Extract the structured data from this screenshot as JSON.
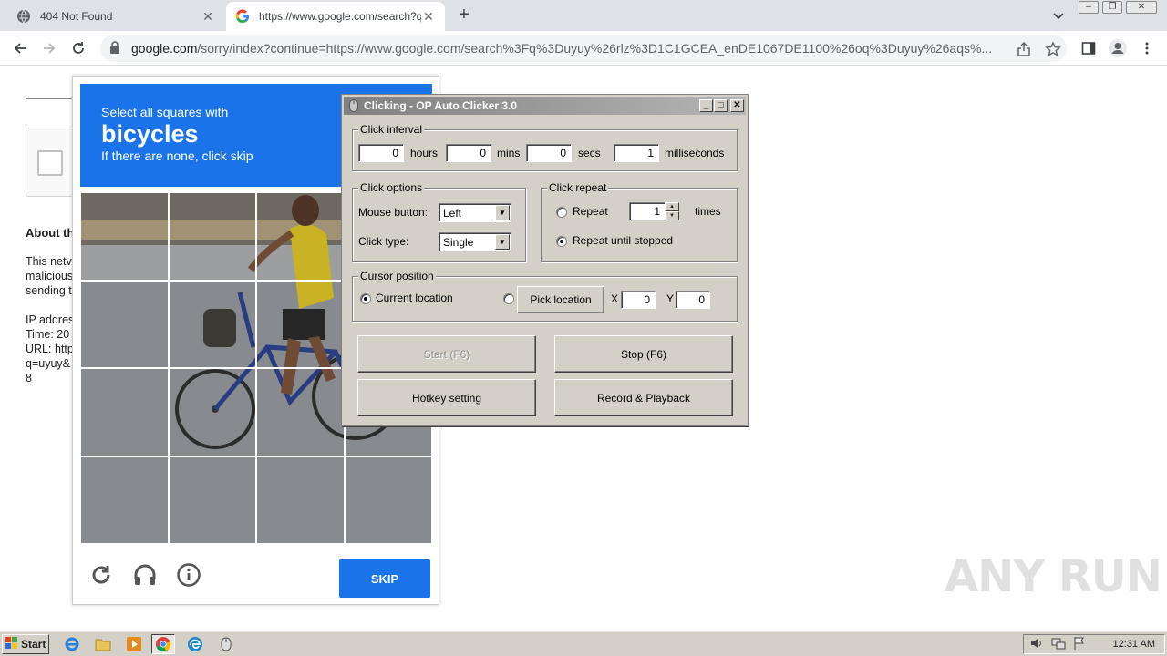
{
  "browser": {
    "tabs": [
      {
        "title": "404 Not Found",
        "active": false
      },
      {
        "title": "https://www.google.com/search?q=",
        "active": true
      }
    ],
    "new_tab_symbol": "+",
    "close_symbol": "✕",
    "url_host": "google.com",
    "url_rest": "/sorry/index?continue=https://www.google.com/search%3Fq%3Duyuy%26rlz%3D1C1GCEA_enDE1067DE1100%26oq%3Duyuy%26aqs%..."
  },
  "page": {
    "about_heading": "About th",
    "lines": [
      "This netv",
      "malicious",
      "sending t",
      "",
      "IP addres",
      "Time: 20",
      "URL: http",
      "q=uyuy&",
      "8"
    ]
  },
  "captcha": {
    "instruction": "Select all squares with",
    "keyword": "bicycles",
    "hint": "If there are none, click skip",
    "skip_label": "SKIP",
    "grid_size": 4
  },
  "clicker": {
    "title": "Clicking - OP Auto Clicker 3.0",
    "interval": {
      "label": "Click interval",
      "hours": "0",
      "hours_label": "hours",
      "mins": "0",
      "mins_label": "mins",
      "secs": "0",
      "secs_label": "secs",
      "ms": "1",
      "ms_label": "milliseconds"
    },
    "options": {
      "label": "Click options",
      "mouse_button_label": "Mouse button:",
      "mouse_button": "Left",
      "click_type_label": "Click type:",
      "click_type": "Single"
    },
    "repeat": {
      "label": "Click repeat",
      "repeat_label": "Repeat",
      "repeat_count": "1",
      "times_label": "times",
      "until_stopped_label": "Repeat until stopped",
      "selected": "until_stopped"
    },
    "cursor": {
      "label": "Cursor position",
      "current_label": "Current location",
      "pick_label": "Pick location",
      "x_label": "X",
      "x": "0",
      "y_label": "Y",
      "y": "0",
      "selected": "current"
    },
    "buttons": {
      "start": "Start (F6)",
      "stop": "Stop (F6)",
      "hotkey": "Hotkey setting",
      "record": "Record & Playback"
    }
  },
  "watermark": "ANY RUN",
  "taskbar": {
    "start_label": "Start",
    "clock": "12:31 AM"
  }
}
